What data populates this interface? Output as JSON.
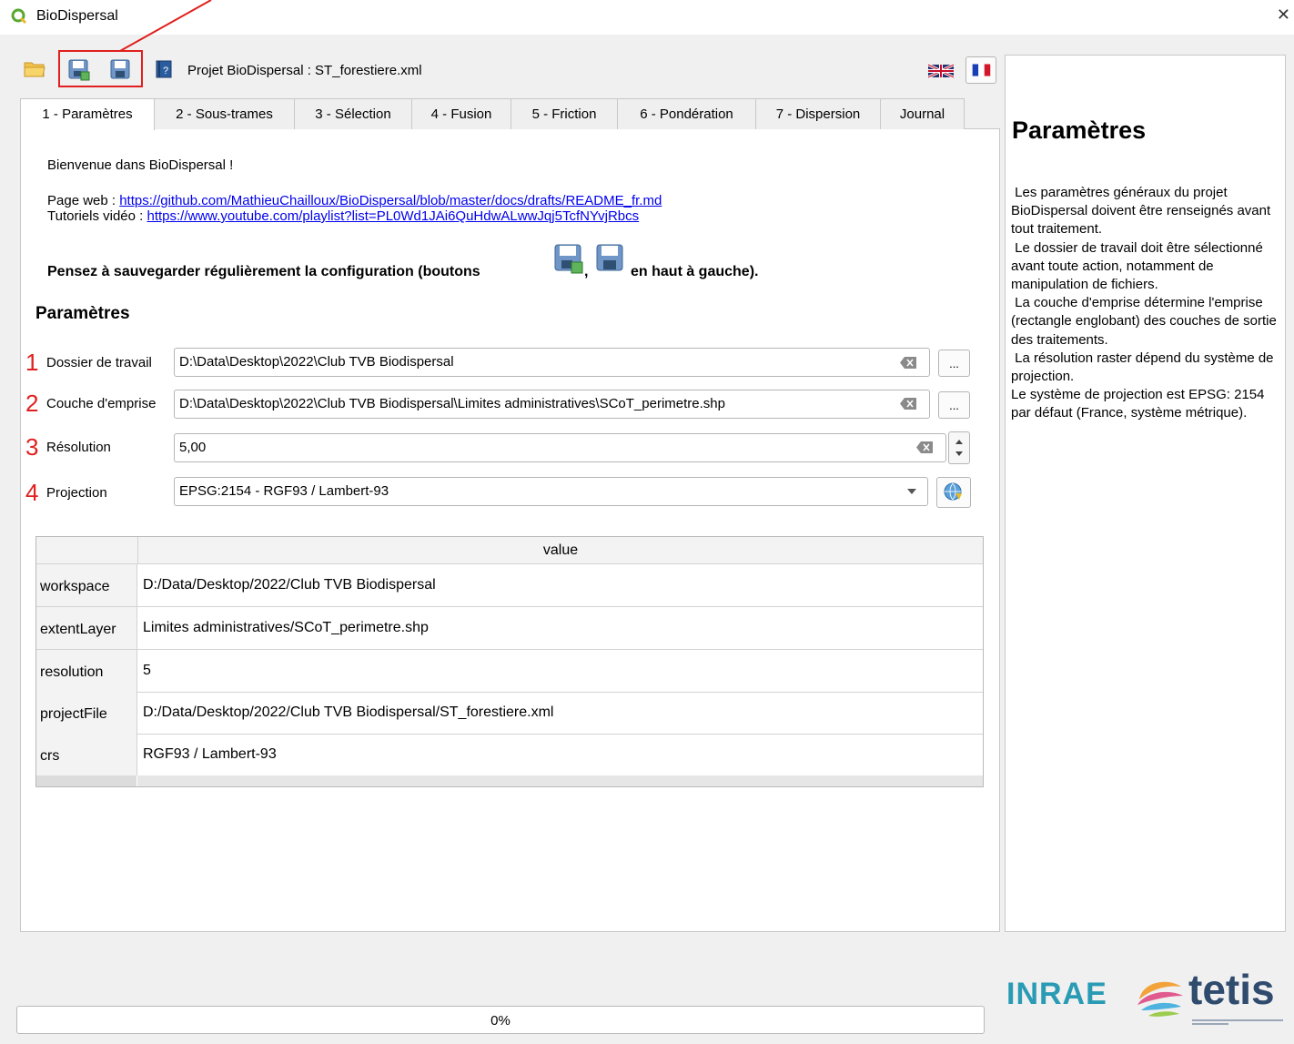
{
  "window": {
    "title": "BioDispersal"
  },
  "toolbar": {
    "project_label": "Projet BioDispersal : ST_forestiere.xml",
    "icons": [
      "folder-open-icon",
      "save-as-icon",
      "save-icon",
      "help-book-icon"
    ],
    "flags": [
      "uk-flag-icon",
      "fr-flag-icon"
    ]
  },
  "tabs": [
    {
      "label": "1 - Paramètres",
      "active": true
    },
    {
      "label": "2 - Sous-trames"
    },
    {
      "label": "3 - Sélection"
    },
    {
      "label": "4 - Fusion"
    },
    {
      "label": "5 - Friction"
    },
    {
      "label": "6 - Pondération"
    },
    {
      "label": "7 - Dispersion"
    },
    {
      "label": "Journal"
    }
  ],
  "main": {
    "welcome": "Bienvenue dans BioDispersal !",
    "web_label": "Page web : ",
    "web_url": "https://github.com/MathieuChailloux/BioDispersal/blob/master/docs/drafts/README_fr.md",
    "video_label": "Tutoriels vidéo : ",
    "video_url": "https://www.youtube.com/playlist?list=PL0Wd1JAi6QuHdwALwwJqj5TcfNYvjRbcs",
    "save_note": "Pensez à sauvegarder régulièrement la configuration (boutons",
    "save_note_sep": ",",
    "save_note_tail": "en haut à gauche).",
    "section_title": "Paramètres"
  },
  "form": {
    "workspace": {
      "number": "1",
      "label": "Dossier de travail",
      "value": "D:\\Data\\Desktop\\2022\\Club TVB Biodispersal",
      "button": "..."
    },
    "extent": {
      "number": "2",
      "label": "Couche d'emprise",
      "value": "D:\\Data\\Desktop\\2022\\Club TVB Biodispersal\\Limites administratives\\SCoT_perimetre.shp",
      "button": "..."
    },
    "resolution": {
      "number": "3",
      "label": "Résolution",
      "value": "5,00"
    },
    "projection": {
      "number": "4",
      "label": "Projection",
      "value": "EPSG:2154 - RGF93 / Lambert-93"
    }
  },
  "table": {
    "header": "value",
    "rows": [
      {
        "key": "workspace",
        "value": "D:/Data/Desktop/2022/Club TVB Biodispersal"
      },
      {
        "key": "extentLayer",
        "value": "Limites administratives/SCoT_perimetre.shp"
      },
      {
        "key": "resolution",
        "value": "5"
      },
      {
        "key": "projectFile",
        "value": "D:/Data/Desktop/2022/Club TVB Biodispersal/ST_forestiere.xml"
      },
      {
        "key": "crs",
        "value": "RGF93 / Lambert-93"
      }
    ]
  },
  "help": {
    "title": "Paramètres",
    "body": " Les paramètres généraux du projet BioDispersal doivent être renseignés avant tout traitement.\n Le dossier de travail doit être sélectionné avant toute action, notamment de manipulation de fichiers.\n La couche d'emprise détermine l'emprise (rectangle englobant) des couches de sortie des traitements.\n La résolution raster dépend du système de projection.\nLe système de projection est EPSG: 2154 par défaut (France, système métrique)."
  },
  "logos": {
    "inrae": "INRAE",
    "tetis": "tetis"
  },
  "progress": {
    "text": "0%",
    "value": 0
  },
  "colors": {
    "annotation_red": "#e0201e",
    "link_blue": "#0000ee"
  }
}
